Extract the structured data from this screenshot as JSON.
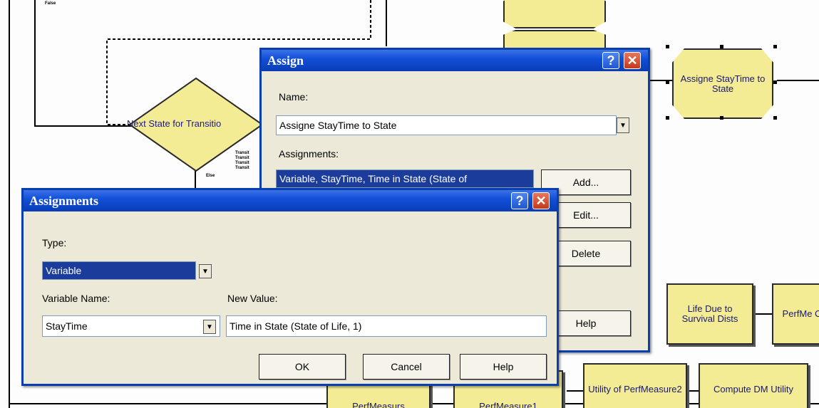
{
  "canvas": {
    "decision_label": "Next State for Transitio",
    "small_false_1": "False",
    "small_false_2": "Else",
    "small_trans": [
      "Transit",
      "Transit",
      "Transit",
      "Transit"
    ],
    "modules": {
      "assigne_stay": "Assigne StayTime to State",
      "life_due": "Life Due to Survival Dists",
      "perfme_c": "PerfMe C",
      "perfmeasurs": "PerfMeasurs",
      "perfmeasure1": "PerfMeasure1",
      "utility_pm2": "Utility of PerfMeasure2",
      "compute_dm": "Compute DM Utility"
    }
  },
  "assign_dialog": {
    "title": "Assign",
    "name_label": "Name:",
    "name_value": "Assigne  StayTime to State",
    "assignments_label": "Assignments:",
    "assignment_row": "Variable, StayTime, Time in State (State of",
    "add_label": "Add...",
    "edit_label": "Edit...",
    "delete_label": "Delete",
    "help_label": "Help"
  },
  "assignments_dialog": {
    "title": "Assignments",
    "type_label": "Type:",
    "type_value": "Variable",
    "varname_label": "Variable Name:",
    "varname_value": "StayTime",
    "newvalue_label": "New Value:",
    "newvalue_value": "Time in State (State of Life, 1)",
    "ok_label": "OK",
    "cancel_label": "Cancel",
    "help_label": "Help"
  },
  "icons": {
    "help": "?",
    "close": "✕",
    "dropdown": "▼"
  },
  "colors": {
    "titlebar": "#1150d9",
    "module_fill": "#f4ec94",
    "dialog_bg": "#ece9d8",
    "selection": "#1c3c9c"
  }
}
